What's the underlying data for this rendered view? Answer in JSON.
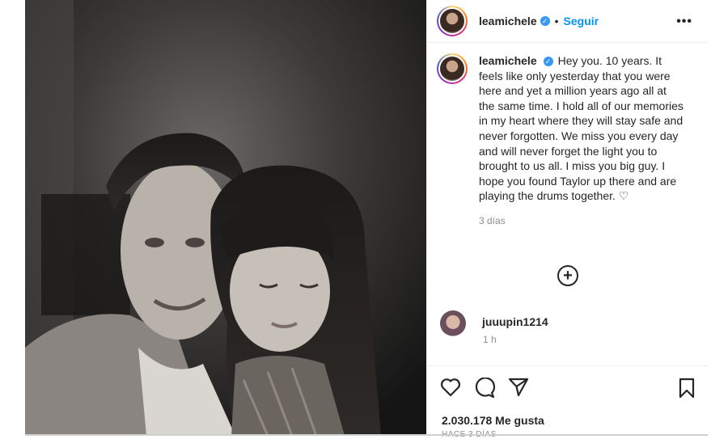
{
  "header": {
    "username": "leamichele",
    "separator": "•",
    "follow_label": "Seguir",
    "more_label": "•••"
  },
  "caption": {
    "username": "leamichele",
    "text": "Hey you. 10 years. It feels like only yesterday that you were here and yet a million years ago all at the same time. I hold all of our memories in my heart where they will stay safe and never forgotten. We miss you every day and will never forget the light you to brought to us all. I miss you big guy. I hope you found Taylor up there and are playing the drums together. ♡",
    "time": "3 días"
  },
  "load_more": "+",
  "comment": {
    "username": "juuupin1214",
    "time": "1 h"
  },
  "actions": {
    "icons": [
      "heart-icon",
      "comment-icon",
      "share-icon",
      "bookmark-icon"
    ]
  },
  "likes": "2.030.178 Me gusta",
  "ago": "HACE 3 DÍAS",
  "colors": {
    "follow": "#0095f6",
    "verified": "#3897f0",
    "text": "#262626",
    "muted": "#8e8e8e"
  }
}
